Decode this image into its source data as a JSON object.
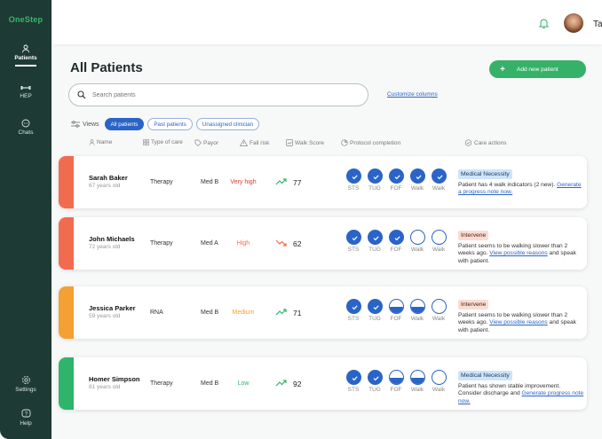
{
  "app": {
    "brand": "OneStep"
  },
  "sidebar": {
    "items": [
      {
        "label": "Patients",
        "icon": "patients-icon",
        "active": true
      },
      {
        "label": "HEP",
        "icon": "dumbbell-icon"
      },
      {
        "label": "Chats",
        "icon": "chat-icon"
      }
    ],
    "bottom": [
      {
        "label": "Settings",
        "icon": "gear-icon"
      },
      {
        "label": "Help",
        "icon": "help-icon"
      }
    ]
  },
  "header": {
    "user_name": "Tara"
  },
  "page": {
    "title": "All Patients",
    "add_button": "Add new patient",
    "search_placeholder": "Search patients",
    "customize": "Customize columns",
    "views_label": "Views",
    "views": [
      "All patients",
      "Past patients",
      "Unassigned clinician"
    ],
    "active_view": "All patients"
  },
  "columns": {
    "name": "Name",
    "care": "Type of care",
    "payor": "Payor",
    "risk": "Fall risk",
    "score": "Walk Score",
    "protocol": "Protocol completion",
    "actions": "Care actions"
  },
  "protocol_labels": [
    "STS",
    "TUG",
    "FOF",
    "Walk",
    "Walk"
  ],
  "colors": {
    "accent": "#2a64c7",
    "brand": "#36b168",
    "sidebar": "#1e3a34",
    "high_risk": "#f26b4f",
    "medium_risk": "#f5a033",
    "low_risk": "#2fb46c"
  },
  "patients": [
    {
      "name": "Sarah Baker",
      "age": "67 years old",
      "care": "Therapy",
      "payor": "Med B",
      "risk": "Very high",
      "risk_color": "#d63b2d",
      "band_color": "#f26b4f",
      "trend": "up",
      "trend_color": "#2fb46c",
      "score": "77",
      "protocol": [
        "full",
        "full",
        "full",
        "full",
        "full"
      ],
      "action_badge": "Medical Necessity",
      "badge_type": "blue",
      "note_pre": "Patient has 4 walk indicators (2 new).",
      "note_link": "Generate a progress note now.",
      "note_post": ""
    },
    {
      "name": "John Michaels",
      "age": "72 years old",
      "care": "Therapy",
      "payor": "Med A",
      "risk": "High",
      "risk_color": "#f26b4f",
      "band_color": "#f26b4f",
      "trend": "down",
      "trend_color": "#f26b4f",
      "score": "62",
      "protocol": [
        "full",
        "full",
        "full",
        "empty",
        "empty"
      ],
      "action_badge": "Intervene",
      "badge_type": "red",
      "note_pre": "Patient seems to be walking slower than 2 weeks ago.",
      "note_link": "View possible reasons",
      "note_post": "and speak with patient."
    },
    {
      "name": "Jessica Parker",
      "age": "59 years old",
      "care": "RNA",
      "payor": "Med B",
      "risk": "Medium",
      "risk_color": "#f5a033",
      "band_color": "#f5a033",
      "trend": "up",
      "trend_color": "#2fb46c",
      "score": "71",
      "protocol": [
        "full",
        "full",
        "half",
        "half",
        "empty"
      ],
      "action_badge": "Intervene",
      "badge_type": "red",
      "note_pre": "Patient seems to be walking slower than 2 weeks ago.",
      "note_link": "View possible reasons",
      "note_post": "and speak with patient."
    },
    {
      "name": "Homer Simpson",
      "age": "81 years old",
      "care": "Therapy",
      "payor": "Med B",
      "risk": "Low",
      "risk_color": "#2fb46c",
      "band_color": "#2fb46c",
      "trend": "up",
      "trend_color": "#2fb46c",
      "score": "92",
      "protocol": [
        "full",
        "full",
        "half",
        "half",
        "empty"
      ],
      "action_badge": "Medical Necessity",
      "badge_type": "blue",
      "note_pre": "Patient has shown stable improvement. Consider discharge and",
      "note_link": "Generate progress note now.",
      "note_post": ""
    }
  ]
}
